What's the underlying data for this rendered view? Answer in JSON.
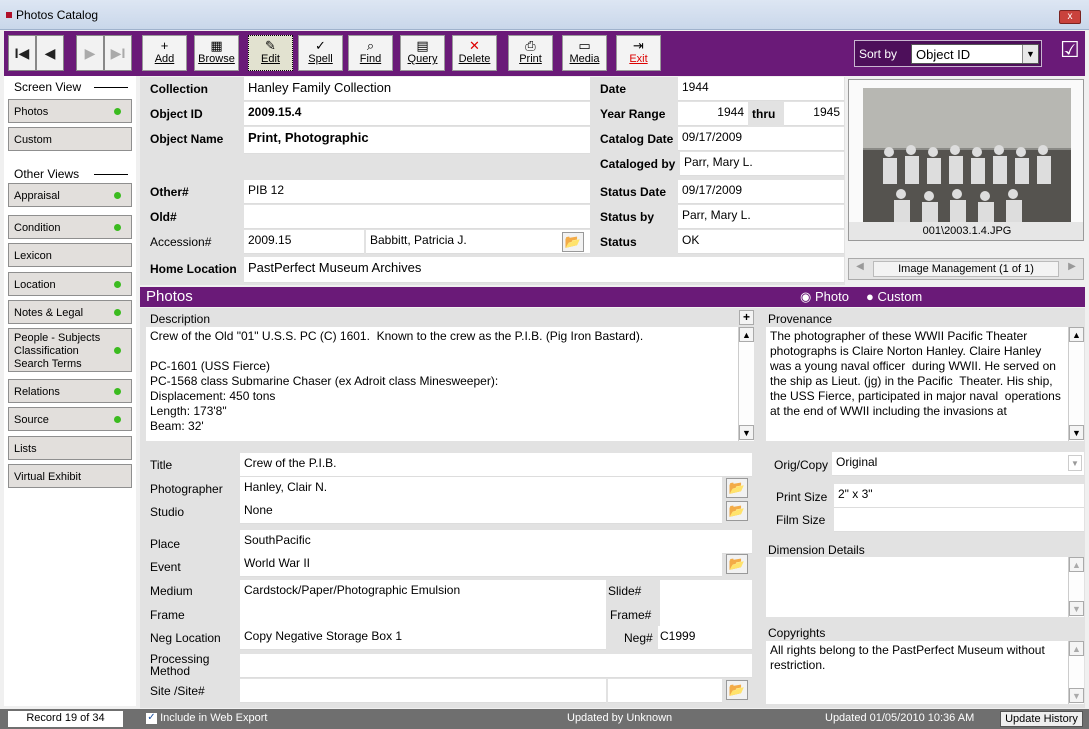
{
  "window": {
    "title": "Photos Catalog",
    "close": "x"
  },
  "nav": {
    "first": "I◀",
    "prev": "◀",
    "next": "▶",
    "last": "▶I"
  },
  "toolbar": [
    {
      "icon": "+",
      "label": "Add"
    },
    {
      "icon": "▦",
      "label": "Browse"
    },
    {
      "icon": "✎",
      "label": "Edit"
    },
    {
      "icon": "✓",
      "label": "Spell"
    },
    {
      "icon": "⌕",
      "label": "Find"
    },
    {
      "icon": "▤",
      "label": "Query"
    },
    {
      "icon": "✕",
      "label": "Delete"
    },
    {
      "icon": "⎙",
      "label": "Print"
    },
    {
      "icon": "▭",
      "label": "Media"
    },
    {
      "icon": "⇥",
      "label": "Exit"
    }
  ],
  "sort": {
    "label": "Sort by",
    "value": "Object ID"
  },
  "sidebar": {
    "screen_view": "Screen View",
    "screen_items": [
      {
        "label": "Photos",
        "dot": true
      },
      {
        "label": "Custom",
        "dot": false
      }
    ],
    "other_views": "Other Views",
    "other_items": [
      {
        "label": "Appraisal",
        "dot": true
      },
      {
        "label": "Condition",
        "dot": true
      },
      {
        "label": "Lexicon",
        "dot": false
      },
      {
        "label": "Location",
        "dot": true
      },
      {
        "label": "Notes & Legal",
        "dot": true
      },
      {
        "label": "People - Subjects Classification Search Terms",
        "dot": true
      },
      {
        "label": "Relations",
        "dot": true
      },
      {
        "label": "Source",
        "dot": true
      },
      {
        "label": "Lists",
        "dot": false
      },
      {
        "label": "Virtual Exhibit",
        "dot": false
      }
    ]
  },
  "header": {
    "collection_label": "Collection",
    "collection": "Hanley Family Collection",
    "object_id_label": "Object ID",
    "object_id": "2009.15.4",
    "object_name_label": "Object Name",
    "object_name": "Print, Photographic",
    "other_label": "Other#",
    "other": "PIB 12",
    "old_label": "Old#",
    "old": "",
    "accession_label": "Accession#",
    "accession": "2009.15",
    "accession_person": "Babbitt, Patricia J.",
    "home_label": "Home Location",
    "home": "PastPerfect Museum Archives",
    "date_label": "Date",
    "date": "1944",
    "year_range_label": "Year Range",
    "year_from": "1944",
    "thru": "thru",
    "year_to": "1945",
    "catalog_date_label": "Catalog Date",
    "catalog_date": "09/17/2009",
    "cataloged_by_label": "Cataloged by",
    "cataloged_by": "Parr, Mary L.",
    "status_date_label": "Status Date",
    "status_date": "09/17/2009",
    "status_by_label": "Status by",
    "status_by": "Parr, Mary L.",
    "status_label": "Status",
    "status": "OK"
  },
  "image": {
    "filename": "001\\2003.1.4.JPG",
    "manage": "Image Management (1 of 1)"
  },
  "section": {
    "title": "Photos",
    "radio_photo": "Photo",
    "radio_custom": "Custom"
  },
  "description": {
    "label": "Description",
    "text": "Crew of the Old \"01\" U.S.S. PC (C) 1601.  Known to the crew as the P.I.B. (Pig Iron Bastard).\n\nPC-1601 (USS Fierce)\nPC-1568 class Submarine Chaser (ex Adroit class Minesweeper):\nDisplacement: 450 tons\nLength: 173'8\"\nBeam: 32'"
  },
  "provenance": {
    "label": "Provenance",
    "text": "The photographer of these WWII Pacific Theater photographs is Claire Norton Hanley. Claire Hanley was a young naval officer  during WWII. He served on the ship as Lieut. (jg) in the Pacific  Theater. His ship, the USS Fierce, participated in major naval  operations at the end of WWII including the invasions at"
  },
  "fields": {
    "title_label": "Title",
    "title": "Crew of the P.I.B.",
    "photographer_label": "Photographer",
    "photographer": "Hanley, Clair N.",
    "studio_label": "Studio",
    "studio": "None",
    "place_label": "Place",
    "place": "SouthPacific",
    "event_label": "Event",
    "event": "World War II",
    "medium_label": "Medium",
    "medium": "Cardstock/Paper/Photographic Emulsion",
    "frame_label": "Frame",
    "frame": "",
    "neg_location_label": "Neg Location",
    "neg_location": "Copy Negative Storage Box 1",
    "processing_label": "Processing Method",
    "processing": "",
    "site_label": "Site /Site#",
    "site": "",
    "slide_label": "Slide#",
    "slide": "",
    "frame_no_label": "Frame#",
    "frame_no": "",
    "neg_label": "Neg#",
    "neg": "C1999"
  },
  "right": {
    "orig_label": "Orig/Copy",
    "orig": "Original",
    "print_size_label": "Print Size",
    "print_size": "2\" x 3\"",
    "film_size_label": "Film Size",
    "film_size": "",
    "dimension_label": "Dimension Details",
    "copyrights_label": "Copyrights",
    "copyrights": "All rights belong to the PastPerfect Museum without restriction."
  },
  "status": {
    "record": "Record 19 of 34",
    "web_export": "Include in Web Export",
    "updated_by": "Updated by  Unknown",
    "updated": "Updated   01/05/2010 10:36 AM",
    "update_history": "Update History"
  }
}
